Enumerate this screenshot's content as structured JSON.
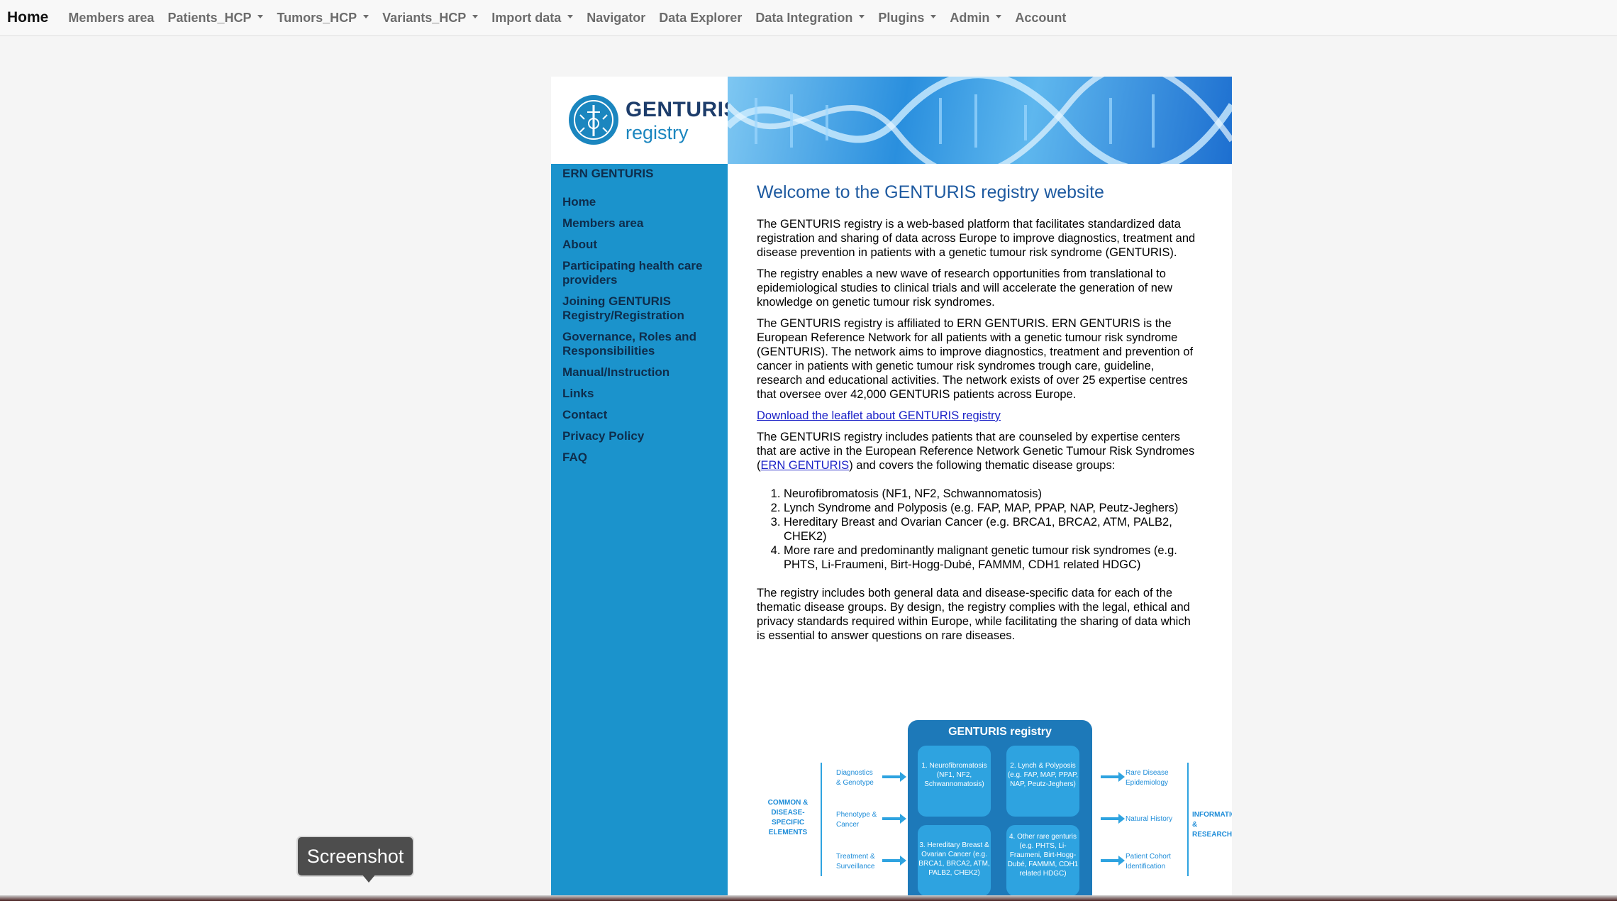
{
  "navbar": {
    "brand": "Home",
    "items": [
      {
        "label": "Members area",
        "dropdown": false
      },
      {
        "label": "Patients_HCP",
        "dropdown": true
      },
      {
        "label": "Tumors_HCP",
        "dropdown": true
      },
      {
        "label": "Variants_HCP",
        "dropdown": true
      },
      {
        "label": "Import data",
        "dropdown": true
      },
      {
        "label": "Navigator",
        "dropdown": false
      },
      {
        "label": "Data Explorer",
        "dropdown": false
      },
      {
        "label": "Data Integration",
        "dropdown": true
      },
      {
        "label": "Plugins",
        "dropdown": true
      },
      {
        "label": "Admin",
        "dropdown": true
      },
      {
        "label": "Account",
        "dropdown": false
      }
    ]
  },
  "logo": {
    "line1": "GENTURIS",
    "line2": "registry"
  },
  "sidebar": {
    "title": "ERN GENTURIS",
    "items": [
      "Home",
      "Members area",
      "About",
      "Participating health care providers",
      "Joining GENTURIS Registry/Registration",
      "Governance, Roles and Responsibilities",
      "Manual/Instruction",
      "Links",
      "Contact",
      "Privacy Policy",
      "FAQ"
    ]
  },
  "main": {
    "title": "Welcome to the GENTURIS registry website",
    "p1": "The GENTURIS registry is a web-based platform that facilitates standardized data registration and sharing of data across Europe to improve diagnostics, treatment and disease prevention in patients with a genetic tumour risk syndrome (GENTURIS).",
    "p2": "The registry enables a new wave of research opportunities from translational to epidemiological studies to clinical trials and will accelerate the generation of new knowledge on genetic tumour risk syndromes.",
    "p3": "The GENTURIS registry is affiliated to ERN GENTURIS. ERN GENTURIS is the European Reference Network for all patients with a genetic tumour risk syndrome (GENTURIS). The network aims to improve diagnostics, treatment and prevention of cancer in patients with genetic tumour risk syndromes trough care, guideline, research and educational activities. The network exists of over 25 expertise centres that oversee over 42,000 GENTURIS patients across Europe.",
    "leaflet_link": "Download the leaflet about GENTURIS registry",
    "p4_before": "The GENTURIS registry includes patients that are counseled by expertise centers that are active in the European Reference Network Genetic Tumour Risk Syndromes (",
    "p4_link": "ERN GENTURIS",
    "p4_after": ") and covers the following thematic disease groups:",
    "groups": [
      "Neurofibromatosis (NF1, NF2, Schwannomatosis)",
      "Lynch Syndrome and Polyposis (e.g. FAP, MAP, PPAP, NAP, Peutz-Jeghers)",
      "Hereditary Breast and Ovarian Cancer (e.g. BRCA1, BRCA2, ATM, PALB2, CHEK2)",
      "More rare and predominantly malignant genetic tumour risk syndromes (e.g. PHTS, Li-Fraumeni, Birt-Hogg-Dubé, FAMMM, CDH1 related HDGC)"
    ],
    "p5": "The registry includes both general data and disease-specific data for each of the thematic disease groups. By design, the registry complies with the legal, ethical and privacy standards required within Europe, while facilitating the sharing of data which is essential to answer questions on rare diseases."
  },
  "diagram": {
    "title": "GENTURIS registry",
    "box1": "1. Neurofibromatosis (NF1, NF2, Schwannomatosis)",
    "box2": "2. Lynch & Polyposis (e.g. FAP, MAP, PPAP, NAP, Peutz-Jeghers)",
    "box3": "3. Hereditary Breast & Ovarian Cancer (e.g. BRCA1, BRCA2, ATM, PALB2, CHEK2)",
    "box4": "4. Other rare genturis (e.g. PHTS, Li-Fraumeni, Birt-Hogg-Dubé, FAMMM, CDH1 related HDGC)",
    "left_group": "COMMON & DISEASE-SPECIFIC ELEMENTS",
    "left_items": [
      "Diagnostics & Genotype",
      "Phenotype & Cancer",
      "Treatment & Surveillance"
    ],
    "right_items": [
      "Rare Disease Epidemiology",
      "Natural History",
      "Patient Cohort Identification"
    ],
    "right_group": "INFORMATION & RESEARCH"
  },
  "tooltip": {
    "label": "Screenshot"
  }
}
